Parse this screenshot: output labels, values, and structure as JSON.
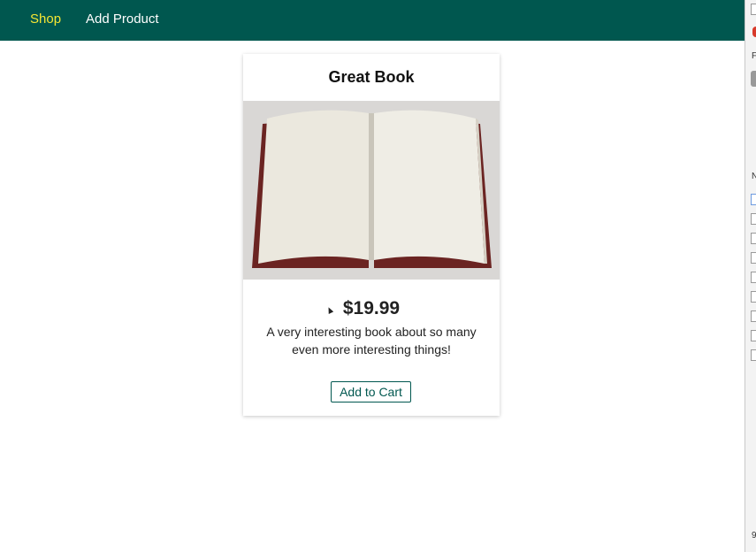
{
  "nav": {
    "items": [
      {
        "label": "Shop",
        "active": true
      },
      {
        "label": "Add Product",
        "active": false
      }
    ]
  },
  "product": {
    "title": "Great Book",
    "image_alt": "open-book-icon",
    "price": "$19.99",
    "description": "A very interesting book about so many even more interesting things!",
    "add_to_cart_label": "Add to Cart"
  },
  "devtools": {
    "letters": {
      "f": "F",
      "n": "N",
      "num": "9"
    }
  },
  "colors": {
    "topbar": "#00574f",
    "nav_active": "#f5e633",
    "nav_inactive": "#ffffff",
    "button_border": "#00574f"
  }
}
